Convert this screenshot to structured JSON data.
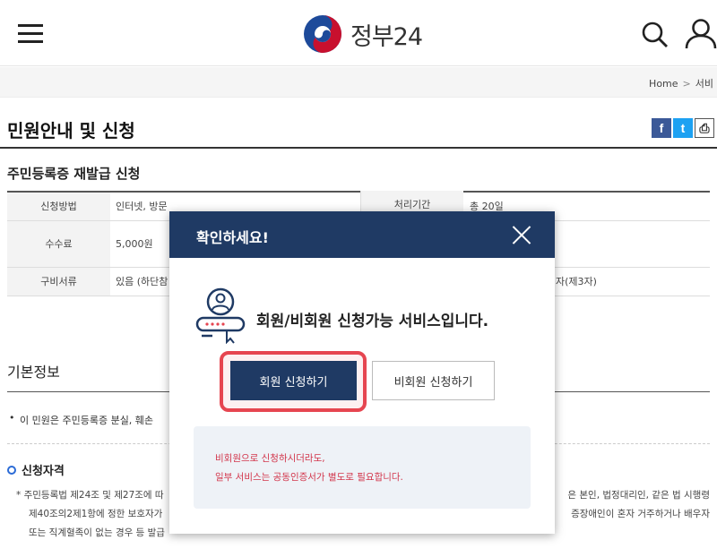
{
  "header": {
    "logo_text": "정부24",
    "brand_colors": {
      "red": "#c8102e",
      "blue": "#1d4a9a"
    }
  },
  "breadcrumb": {
    "home": "Home",
    "separator": ">",
    "current": "서비"
  },
  "page": {
    "title": "민원안내 및 신청",
    "share": {
      "facebook": "f",
      "twitter": "t",
      "print": "⎙"
    }
  },
  "service": {
    "title": "주민등록증 재발급 신청",
    "rows": [
      {
        "label": "신청방법",
        "value": "인터넷, 방문",
        "label2": "처리기간",
        "value2": "총 20일"
      },
      {
        "label": "수수료",
        "value": "5,000원"
      },
      {
        "label": "구비서류",
        "value": "있음 (하단참",
        "value2_tail": "자(제3자)"
      }
    ]
  },
  "basic_info": {
    "title": "기본정보",
    "bullet": "이 민원은 주민등록증 분실, 훼손"
  },
  "qualification": {
    "title": "신청자격",
    "lines": [
      "* 주민등록법 제24조 및 제27조에 따",
      "제40조의2제1항에 정한 보호자가",
      "또는 직계혈족이 없는 경우 등 발급"
    ],
    "right_lines": [
      "은 본인, 법정대리인, 같은 법 시행령",
      "증장애인이 혼자 거주하거나 배우자"
    ]
  },
  "modal": {
    "title": "확인하세요!",
    "message": "회원/비회원 신청가능 서비스입니다.",
    "member_button": "회원 신청하기",
    "guest_button": "비회원 신청하기",
    "notice_line1": "비회원으로 신청하시더라도,",
    "notice_line2": "일부 서비스는 공동인증서가 별도로 필요합니다.",
    "colors": {
      "header": "#1f3a64",
      "highlight": "#e64550",
      "notice_text": "#d2354b"
    }
  }
}
